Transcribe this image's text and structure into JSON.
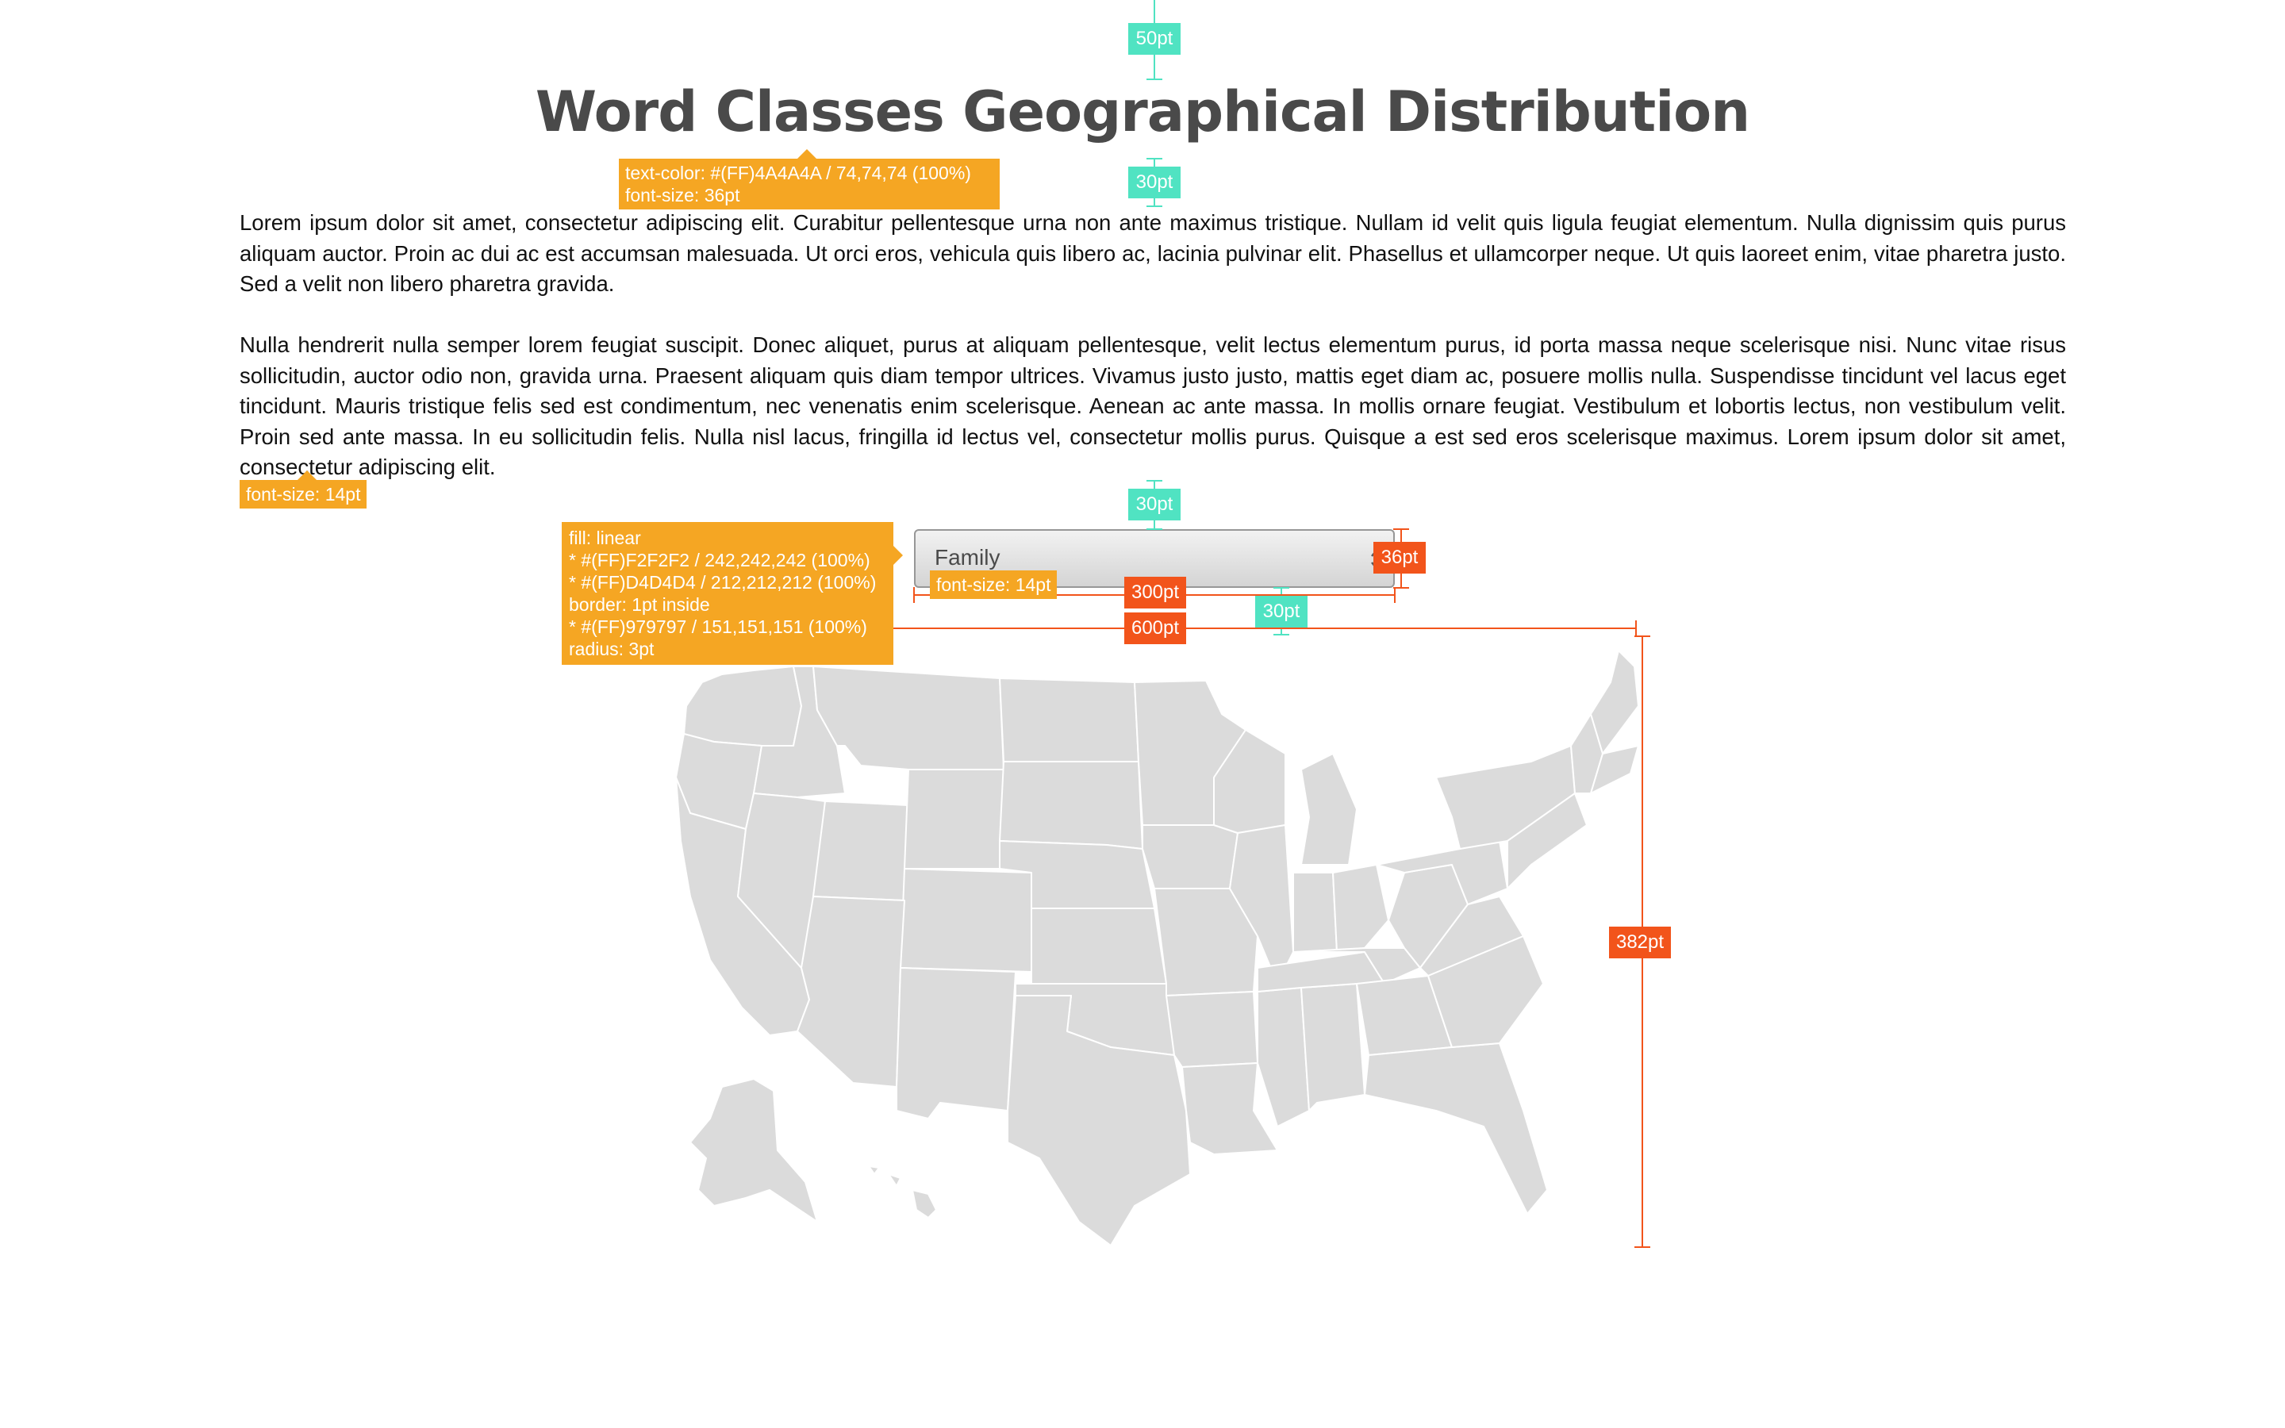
{
  "page": {
    "title": "Word Classes Geographical Distribution",
    "paragraphs": [
      "Lorem ipsum dolor sit amet, consectetur adipiscing elit. Curabitur pellentesque urna non ante maximus tristique. Nullam id velit quis ligula feugiat elementum. Nulla dignissim quis purus aliquam auctor. Proin ac dui ac est accumsan malesuada. Ut orci eros, vehicula quis libero ac, lacinia pulvinar elit. Phasellus et ullamcorper neque. Ut quis laoreet enim, vitae pharetra justo. Sed a velit non libero pharetra gravida.",
      "Nulla hendrerit nulla semper lorem feugiat suscipit. Donec aliquet, purus at aliquam pellentesque, velit lectus elementum purus, id porta massa neque scelerisque nisi. Nunc vitae risus sollicitudin, auctor odio non, gravida urna. Praesent aliquam quis diam tempor ultrices. Vivamus justo justo, mattis eget diam ac, posuere mollis nulla. Suspendisse tincidunt vel lacus eget tincidunt. Mauris tristique felis sed est condimentum, nec venenatis enim scelerisque. Aenean ac ante massa. In mollis ornare feugiat. Vestibulum et lobortis lectus, non vestibulum velit. Proin sed ante massa. In eu sollicitudin felis. Nulla nisl lacus, fringilla id lectus vel, consectetur mollis purus. Quisque a est sed eros scelerisque maximus. Lorem ipsum dolor sit amet, consectetur adipiscing elit."
    ],
    "select": {
      "value": "Family"
    }
  },
  "annotations": {
    "title_spec": [
      "text-color: #(FF)4A4A4A / 74,74,74 (100%)",
      "font-size: 36pt"
    ],
    "body_spec": "font-size: 14pt",
    "select_font_spec": "font-size: 14pt",
    "select_fill_spec": [
      "fill: linear",
      "* #(FF)F2F2F2 / 242,242,242 (100%)",
      "* #(FF)D4D4D4 / 212,212,212 (100%)",
      "border: 1pt inside",
      "* #(FF)979797 / 151,151,151 (100%)",
      "radius: 3pt"
    ],
    "measures": {
      "top_margin": "50pt",
      "title_gap": "30pt",
      "body_gap": "30pt",
      "select_height": "36pt",
      "select_width": "300pt",
      "select_gap_right": "30pt",
      "map_width": "600pt",
      "map_height": "382pt"
    }
  },
  "colors": {
    "title_text": "#4A4A4A",
    "callout": "#F5A623",
    "spacing_guide": "#50E3C2",
    "size_guide": "#F2541B",
    "select_fill_top": "#F2F2F2",
    "select_fill_bottom": "#D4D4D4",
    "select_border": "#979797",
    "map_fill": "#DBDBDB",
    "map_borders": "#FFFFFF"
  },
  "icons": {
    "select_arrows": "up-down-chevron-icon",
    "map": "us-states-map"
  }
}
